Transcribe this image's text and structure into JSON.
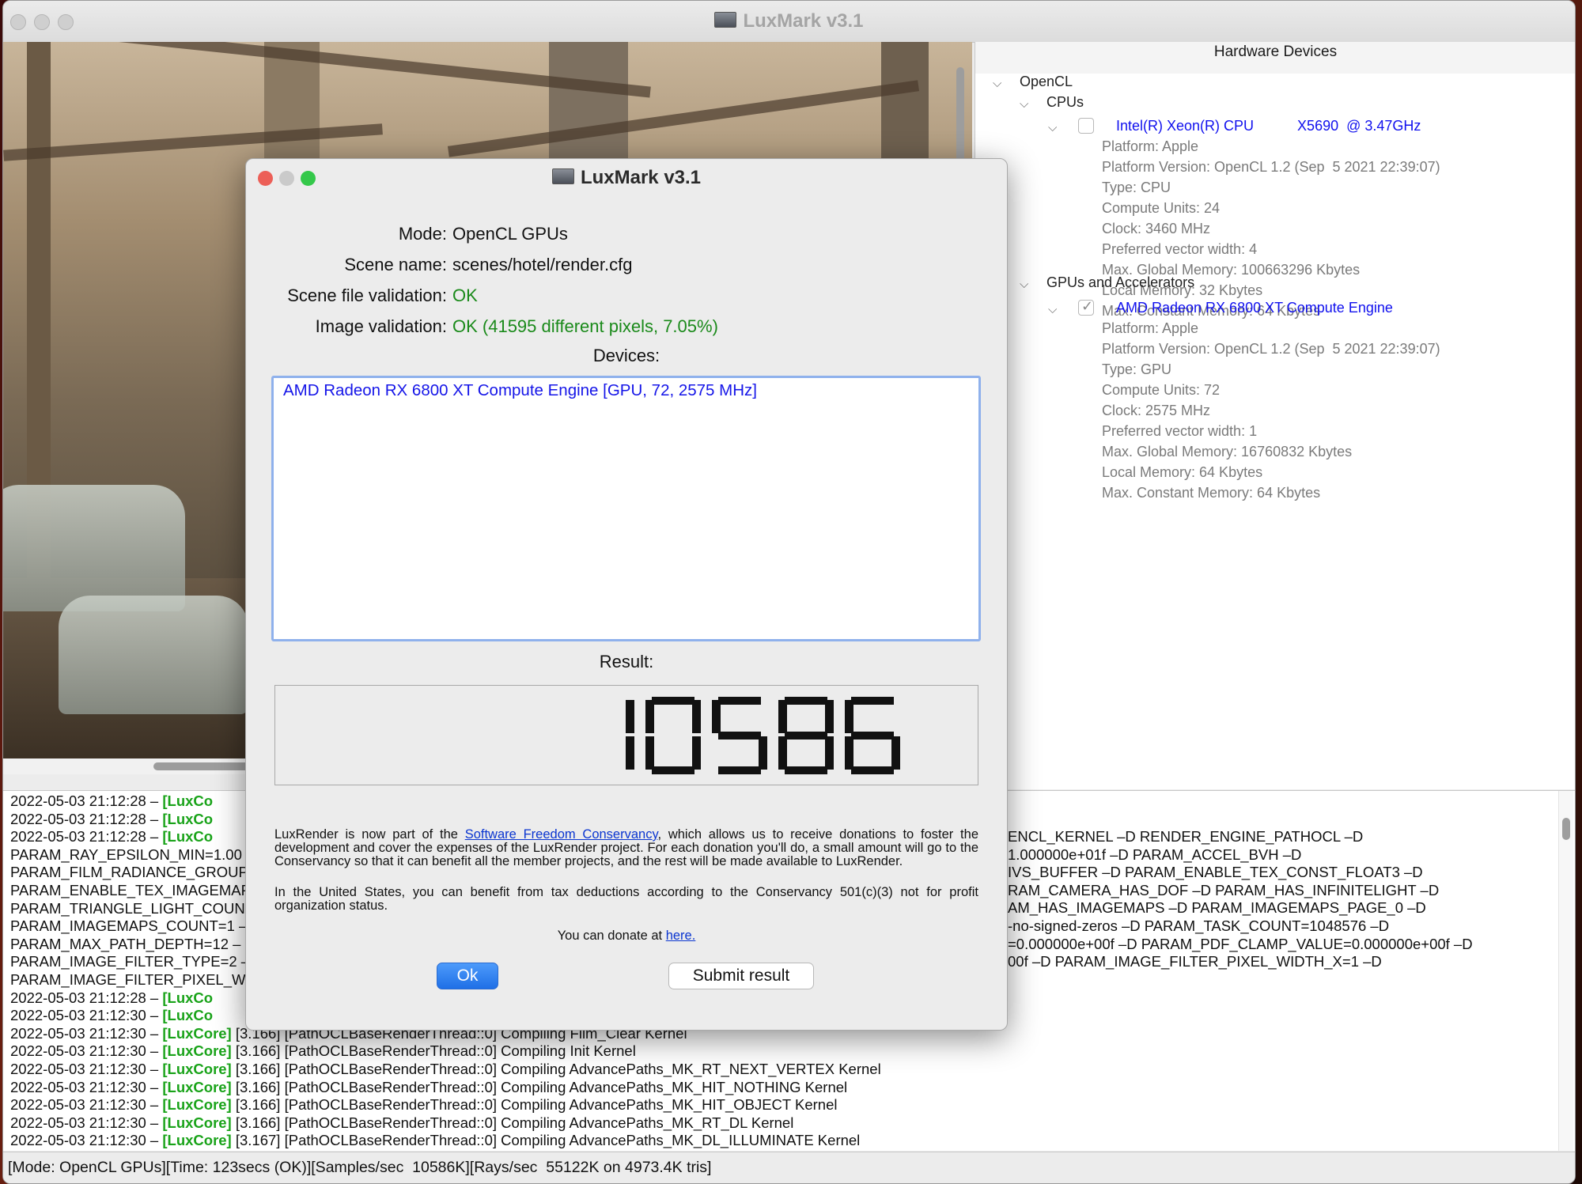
{
  "window": {
    "title": "LuxMark v3.1",
    "render_image": "hotel-lobby-render"
  },
  "devices_panel": {
    "header": "Hardware Devices",
    "tree": {
      "root": "OpenCL",
      "cpus_group": "CPUs",
      "cpu": {
        "name": "Intel(R) Xeon(R) CPU           X5690  @ 3.47GHz",
        "checked": false,
        "props": [
          "Platform: Apple",
          "Platform Version: OpenCL 1.2 (Sep  5 2021 22:39:07)",
          "Type: CPU",
          "Compute Units: 24",
          "Clock: 3460 MHz",
          "Preferred vector width: 4",
          "Max. Global Memory: 100663296 Kbytes",
          "Local Memory: 32 Kbytes",
          "Max. Constant Memory: 64 Kbytes"
        ]
      },
      "gpus_group": "GPUs and Accelerators",
      "gpu": {
        "name": "AMD Radeon RX 6800 XT Compute Engine",
        "checked": true,
        "props": [
          "Platform: Apple",
          "Platform Version: OpenCL 1.2 (Sep  5 2021 22:39:07)",
          "Type: GPU",
          "Compute Units: 72",
          "Clock: 2575 MHz",
          "Preferred vector width: 1",
          "Max. Global Memory: 16760832 Kbytes",
          "Local Memory: 64 Kbytes",
          "Max. Constant Memory: 64 Kbytes"
        ]
      }
    }
  },
  "log": {
    "lines": [
      {
        "ts": "2022-05-03 21:12:28 – ",
        "tag": "[LuxCo",
        "rest": ""
      },
      {
        "ts": "2022-05-03 21:12:28 – ",
        "tag": "[LuxCo",
        "rest": ""
      },
      {
        "ts": "2022-05-03 21:12:28 – ",
        "tag": "[LuxCo",
        "rest": ""
      },
      {
        "ts": "PARAM_RAY_EPSILON_MIN=1.00",
        "tag": "",
        "rest": ""
      },
      {
        "ts": "PARAM_FILM_RADIANCE_GROUP",
        "tag": "",
        "rest": ""
      },
      {
        "ts": "PARAM_ENABLE_TEX_IMAGEMAP",
        "tag": "",
        "rest": ""
      },
      {
        "ts": "PARAM_TRIANGLE_LIGHT_COUN",
        "tag": "",
        "rest": ""
      },
      {
        "ts": "PARAM_IMAGEMAPS_COUNT=1 –",
        "tag": "",
        "rest": ""
      },
      {
        "ts": "PARAM_MAX_PATH_DEPTH=12 –",
        "tag": "",
        "rest": ""
      },
      {
        "ts": "PARAM_IMAGE_FILTER_TYPE=2 –",
        "tag": "",
        "rest": ""
      },
      {
        "ts": "PARAM_IMAGE_FILTER_PIXEL_WI",
        "tag": "",
        "rest": ""
      },
      {
        "ts": "2022-05-03 21:12:28 – ",
        "tag": "[LuxCo",
        "rest": ""
      },
      {
        "ts": "2022-05-03 21:12:30 – ",
        "tag": "[LuxCo",
        "rest": ""
      },
      {
        "ts": "2022-05-03 21:12:30 – ",
        "tag": "[LuxCore]",
        "rest": " [3.166] [PathOCLBaseRenderThread::0] Compiling Film_Clear Kernel"
      },
      {
        "ts": "2022-05-03 21:12:30 – ",
        "tag": "[LuxCore]",
        "rest": " [3.166] [PathOCLBaseRenderThread::0] Compiling Init Kernel"
      },
      {
        "ts": "2022-05-03 21:12:30 – ",
        "tag": "[LuxCore]",
        "rest": " [3.166] [PathOCLBaseRenderThread::0] Compiling AdvancePaths_MK_RT_NEXT_VERTEX Kernel"
      },
      {
        "ts": "2022-05-03 21:12:30 – ",
        "tag": "[LuxCore]",
        "rest": " [3.166] [PathOCLBaseRenderThread::0] Compiling AdvancePaths_MK_HIT_NOTHING Kernel"
      },
      {
        "ts": "2022-05-03 21:12:30 – ",
        "tag": "[LuxCore]",
        "rest": " [3.166] [PathOCLBaseRenderThread::0] Compiling AdvancePaths_MK_HIT_OBJECT Kernel"
      },
      {
        "ts": "2022-05-03 21:12:30 – ",
        "tag": "[LuxCore]",
        "rest": " [3.166] [PathOCLBaseRenderThread::0] Compiling AdvancePaths_MK_RT_DL Kernel"
      },
      {
        "ts": "2022-05-03 21:12:30 – ",
        "tag": "[LuxCore]",
        "rest": " [3.167] [PathOCLBaseRenderThread::0] Compiling AdvancePaths_MK_DL_ILLUMINATE Kernel"
      }
    ],
    "right_fragments": [
      "ENCL_KERNEL –D RENDER_ENGINE_PATHOCL –D",
      "1.000000e+01f –D PARAM_ACCEL_BVH –D",
      "IVS_BUFFER –D PARAM_ENABLE_TEX_CONST_FLOAT3 –D",
      "RAM_CAMERA_HAS_DOF –D PARAM_HAS_INFINITELIGHT –D",
      "AM_HAS_IMAGEMAPS –D PARAM_IMAGEMAPS_PAGE_0 –D",
      "-no-signed-zeros –D PARAM_TASK_COUNT=1048576 –D",
      "=0.000000e+00f –D PARAM_PDF_CLAMP_VALUE=0.000000e+00f –D",
      "00f –D PARAM_IMAGE_FILTER_PIXEL_WIDTH_X=1 –D"
    ]
  },
  "statusbar": "[Mode: OpenCL GPUs][Time: 123secs (OK)][Samples/sec  10586K][Rays/sec  55122K on 4973.4K tris]",
  "dialog": {
    "title": "LuxMark v3.1",
    "fields": {
      "mode_label": "Mode:",
      "mode_value": "OpenCL GPUs",
      "scene_label": "Scene name:",
      "scene_value": "scenes/hotel/render.cfg",
      "scene_validation_label": "Scene file validation:",
      "scene_validation_value": "OK",
      "image_validation_label": "Image validation:",
      "image_validation_value": "OK (41595 different pixels, 7.05%)"
    },
    "devices_label": "Devices:",
    "devices": [
      "AMD Radeon RX 6800 XT Compute Engine [GPU, 72, 2575 MHz]"
    ],
    "result_label": "Result:",
    "result": "10586",
    "para1_before": "LuxRender is now part of the ",
    "para1_link": "Software Freedom Conservancy",
    "para1_after": ", which allows us to receive donations to foster the development and cover the expenses of the LuxRender project. For each donation you'll do, a small amount will go to the Conservancy so that it can benefit all the member projects, and the rest will be made available to LuxRender.",
    "para2": "In the United States, you can benefit from tax deductions according to the Conservancy 501(c)(3) not for profit organization status.",
    "donate_text": "You can donate at ",
    "donate_link": "here.",
    "ok_button": "Ok",
    "submit_button": "Submit result",
    "colors": {
      "ok_green": "#1a8a1a",
      "link_blue": "#0a35d0",
      "device_blue": "#1515e8",
      "close_red": "#ec5f57",
      "minimize_gray": "#cacaca",
      "zoom_green": "#34c84a"
    }
  }
}
